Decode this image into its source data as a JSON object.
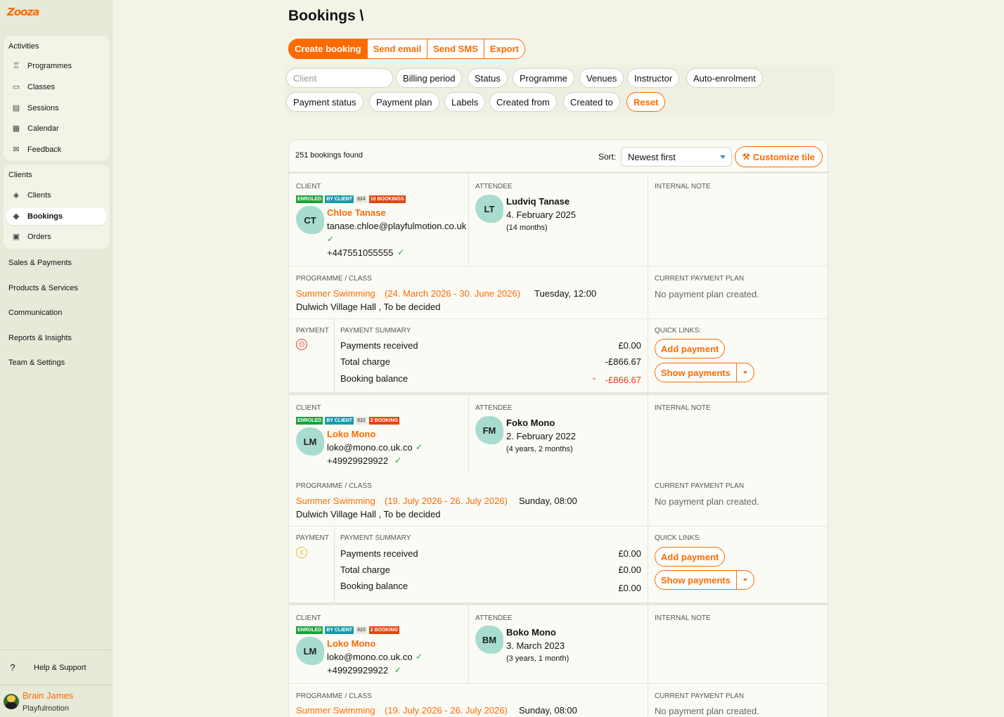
{
  "app": {
    "logo": "Zooza"
  },
  "sidebar": {
    "activities": {
      "label": "Activities",
      "items": [
        {
          "label": "Programmes",
          "icon": "trophy-icon"
        },
        {
          "label": "Classes",
          "icon": "folder-icon"
        },
        {
          "label": "Sessions",
          "icon": "ticket-icon"
        },
        {
          "label": "Calendar",
          "icon": "calendar-icon"
        },
        {
          "label": "Feedback",
          "icon": "mail-icon"
        }
      ]
    },
    "clients": {
      "label": "Clients",
      "items": [
        {
          "label": "Clients",
          "icon": "layers-icon"
        },
        {
          "label": "Bookings",
          "icon": "layers-icon"
        },
        {
          "label": "Orders",
          "icon": "gift-icon"
        }
      ]
    },
    "top": [
      "Sales & Payments",
      "Products & Services",
      "Communication",
      "Reports & Insights",
      "Team & Settings"
    ],
    "help": "Help & Support",
    "user": {
      "name": "Brain James",
      "org": "Playfulmotion"
    }
  },
  "page": {
    "title": "Bookings \\"
  },
  "actions": [
    "Create booking",
    "Send email",
    "Send SMS",
    "Export"
  ],
  "filters": {
    "client_placeholder": "Client",
    "row1": [
      "Billing period",
      "Status",
      "Programme",
      "Venues",
      "Instructor",
      "Auto-enrolment"
    ],
    "row2": [
      "Payment status",
      "Payment plan",
      "Labels",
      "Created from",
      "Created to"
    ],
    "reset": "Reset"
  },
  "list": {
    "found": "251 bookings found",
    "sort_label": "Sort:",
    "sort_value": "Newest first",
    "customize": "Customize tile"
  },
  "labels": {
    "client": "CLIENT",
    "attendee": "ATTENDEE",
    "internal_note": "INTERNAL NOTE",
    "programme": "PROGRAMME / CLASS",
    "payment_plan": "CURRENT PAYMENT PLAN",
    "payment": "PAYMENT",
    "payment_summary": "PAYMENT SUMMARY",
    "quick_links": "QUICK LINKS:",
    "no_plan": "No payment plan created.",
    "payments_received": "Payments received",
    "total_charge": "Total charge",
    "booking_balance": "Booking balance",
    "add_payment": "Add payment",
    "show_payments": "Show payments"
  },
  "bookings": [
    {
      "badges": {
        "enrolled": "ENROLED",
        "by_client": "BY CLIENT",
        "num": "824",
        "count": "10 BOOKINGS"
      },
      "client": {
        "initials": "CT",
        "name": "Chloe Tanase",
        "email": "tanase.chloe@playfulmotion.co.uk",
        "phone": "+447551055555"
      },
      "attendee": {
        "initials": "LT",
        "name": "Ludviq Tanase",
        "dob": "4. February 2025",
        "age": "(14 months)"
      },
      "programme": {
        "name": "Summer Swimming",
        "dates": "(24. March 2026 - 30. June 2026)",
        "time": "Tuesday, 12:00",
        "venue": "Dulwich Village Hall , To be decided"
      },
      "payment": {
        "received": "£0.00",
        "total": "-£866.67",
        "balance": "-£866.67"
      }
    },
    {
      "badges": {
        "enrolled": "ENROLED",
        "by_client": "BY CLIENT",
        "num": "822",
        "count": "2 BOOKING"
      },
      "client": {
        "initials": "LM",
        "name": "Loko Mono",
        "email": "loko@mono.co.uk.co",
        "phone": "+49929929922"
      },
      "attendee": {
        "initials": "FM",
        "name": "Foko Mono",
        "dob": "2. February 2022",
        "age": "(4 years, 2 months)"
      },
      "programme": {
        "name": "Summer Swimming",
        "dates": "(19. July 2026 - 26. July 2026)",
        "time": "Sunday, 08:00",
        "venue": "Dulwich Village Hall , To be decided"
      },
      "payment": {
        "received": "£0.00",
        "total": "£0.00",
        "balance": "£0.00"
      }
    },
    {
      "badges": {
        "enrolled": "ENROLED",
        "by_client": "BY CLIENT",
        "num": "823",
        "count": "2 BOOKING"
      },
      "client": {
        "initials": "LM",
        "name": "Loko Mono",
        "email": "loko@mono.co.uk.co",
        "phone": "+49929929922"
      },
      "attendee": {
        "initials": "BM",
        "name": "Boko Mono",
        "dob": "3. March 2023",
        "age": "(3 years, 1 month)"
      },
      "programme": {
        "name": "Summer Swimming",
        "dates": "(19. July 2026 - 26. July 2026)",
        "time": "Sunday, 08:00"
      }
    }
  ]
}
